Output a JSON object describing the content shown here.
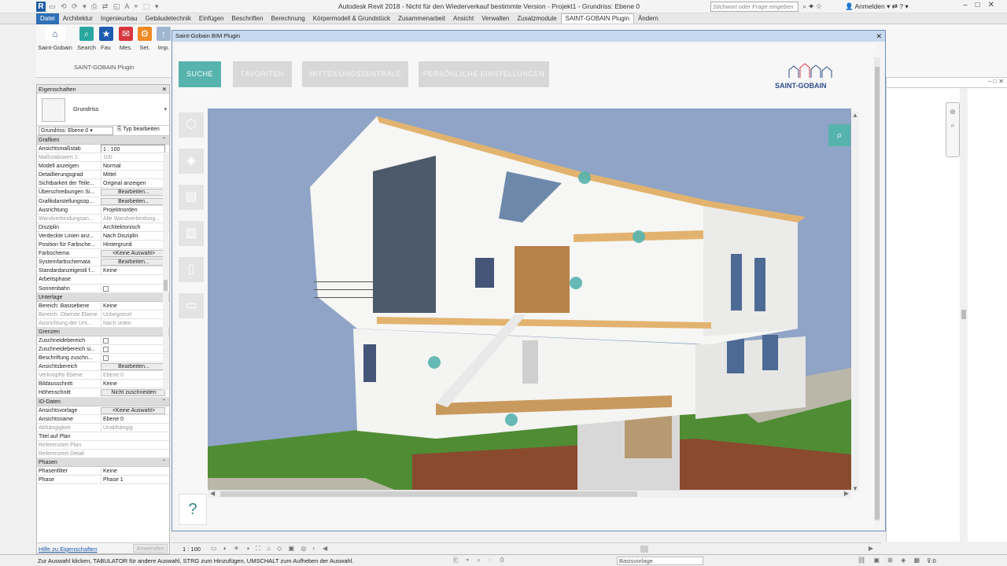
{
  "titlebar": {
    "app_title": "Autodesk Revit 2018 - Nicht für den Wiederverkauf bestimmte Version -   Projekt1 - Grundriss: Ebene 0",
    "search_placeholder": "Stichwort oder Frage eingeben",
    "user": "Anmelden"
  },
  "ribbon": {
    "tabs": [
      "Datei",
      "Architektur",
      "Ingenieurbau",
      "Gebäudetechnik",
      "Einfügen",
      "Beschriften",
      "Berechnung",
      "Körpermodell & Grundstück",
      "Zusammenarbeit",
      "Ansicht",
      "Verwalten",
      "Zusatzmodule",
      "SAINT-GOBAIN Plugin",
      "Ändern"
    ],
    "active_tab": "SAINT-GOBAIN Plugin",
    "buttons": [
      {
        "label": "Saint-Gobain",
        "icon": "saint-gobain-logo-icon",
        "color": "#ffffff"
      },
      {
        "label": "Search",
        "icon": "search-icon",
        "color": "#2aa6a0"
      },
      {
        "label": "Fav.",
        "icon": "star-icon",
        "color": "#1e5bb0"
      },
      {
        "label": "Mes.",
        "icon": "mail-icon",
        "color": "#d9363e"
      },
      {
        "label": "Set.",
        "icon": "gear-icon",
        "color": "#f08a24"
      },
      {
        "label": "Imp.",
        "icon": "upload-icon",
        "color": "#9eb6d0"
      }
    ],
    "panel_name": "SAINT-GOBAIN Plugin"
  },
  "properties": {
    "header": "Eigenschaften",
    "type_name": "Grundriss",
    "selector": "Grundriss: Ebene 0",
    "edit_type": "Typ bearbeiten",
    "groups": [
      {
        "name": "Grafiken",
        "rows": [
          {
            "k": "Ansichtsmaßstab",
            "v": "1 : 100",
            "kind": "input"
          },
          {
            "k": "Maßstabswert 1:",
            "v": "100",
            "dim": true
          },
          {
            "k": "Modell anzeigen",
            "v": "Normal"
          },
          {
            "k": "Detaillierungsgrad",
            "v": "Mittel"
          },
          {
            "k": "Sichtbarkeit der Teile...",
            "v": "Original anzeigen"
          },
          {
            "k": "Überschreibungen Si...",
            "v": "Bearbeiten...",
            "kind": "btn"
          },
          {
            "k": "Grafikdarstellungsop...",
            "v": "Bearbeiten...",
            "kind": "btn"
          },
          {
            "k": "Ausrichtung",
            "v": "Projektnorden"
          },
          {
            "k": "Wandverbindungsan...",
            "v": "Alle Wandverbindung...",
            "dim": true
          },
          {
            "k": "Disziplin",
            "v": "Architektonisch"
          },
          {
            "k": "Verdeckte Linien anz...",
            "v": "Nach Disziplin"
          },
          {
            "k": "Position für Farbsche...",
            "v": "Hintergrund"
          },
          {
            "k": "Farbschema",
            "v": "<Keine Auswahl>",
            "kind": "btn"
          },
          {
            "k": "Systemfarbschemata",
            "v": "Bearbeiten...",
            "kind": "btn"
          },
          {
            "k": "Standardanzeigestil f...",
            "v": "Keine"
          },
          {
            "k": "Arbeitsphase",
            "v": ""
          },
          {
            "k": "Sonnenbahn",
            "v": "",
            "kind": "check"
          }
        ]
      },
      {
        "name": "Unterlage",
        "rows": [
          {
            "k": "Bereich: Basisebene",
            "v": "Keine"
          },
          {
            "k": "Bereich: Oberste Ebene",
            "v": "Unbegrenzt",
            "dim": true
          },
          {
            "k": "Ausrichtung der Unt...",
            "v": "Nach unten",
            "dim": true
          }
        ]
      },
      {
        "name": "Grenzen",
        "rows": [
          {
            "k": "Zuschneidebereich",
            "v": "",
            "kind": "check"
          },
          {
            "k": "Zuschneidebereich si...",
            "v": "",
            "kind": "check"
          },
          {
            "k": "Beschriftung zuschn...",
            "v": "",
            "kind": "check"
          },
          {
            "k": "Ansichtsbereich",
            "v": "Bearbeiten...",
            "kind": "btn"
          },
          {
            "k": "Verknüpfte Ebene",
            "v": "Ebene 0",
            "dim": true
          },
          {
            "k": "Bildausschnitt",
            "v": "Keine"
          },
          {
            "k": "Höhenschnitt",
            "v": "Nicht zuschneiden",
            "kind": "btn"
          }
        ]
      },
      {
        "name": "ID-Daten",
        "rows": [
          {
            "k": "Ansichtsvorlage",
            "v": "<Keine Auswahl>",
            "kind": "btn"
          },
          {
            "k": "Ansichtsname",
            "v": "Ebene 0"
          },
          {
            "k": "Abhängigkeit",
            "v": "Unabhängig",
            "dim": true
          },
          {
            "k": "Titel auf Plan",
            "v": ""
          },
          {
            "k": "Referenziert Plan",
            "v": "",
            "dim": true
          },
          {
            "k": "Referenziert Detail",
            "v": "",
            "dim": true
          }
        ]
      },
      {
        "name": "Phasen",
        "rows": [
          {
            "k": "Phasenfilter",
            "v": "Keine"
          },
          {
            "k": "Phase",
            "v": "Phase 1"
          }
        ]
      }
    ],
    "help_link": "Hilfe zu Eigenschaften",
    "apply": "Anwenden"
  },
  "plugin": {
    "window_title": "Saint-Gobain BIM Plugin",
    "nav": [
      "SUCHE",
      "FAVORITEN",
      "MITTEILUNGSZENTRALE",
      "PERSÖNLICHE EINSTELLUNGEN"
    ],
    "active_nav": "SUCHE",
    "logo_text": "SAINT-GOBAIN",
    "sidebar_icons": [
      "brick-icon",
      "insulation-icon",
      "wall-layer-icon",
      "panel-icon",
      "board-icon",
      "toolbox-icon"
    ],
    "help": "?",
    "accent": "#57b3ad"
  },
  "viewbar": {
    "scale": "1 : 100"
  },
  "statusbar": {
    "message": "Zur Auswahl klicken, TABULATOR für andere Auswahl, STRG zum Hinzufügen, UMSCHALT zum Aufheben der Auswahl.",
    "base_template": "Basisvorlage",
    "filter_count": "0"
  }
}
